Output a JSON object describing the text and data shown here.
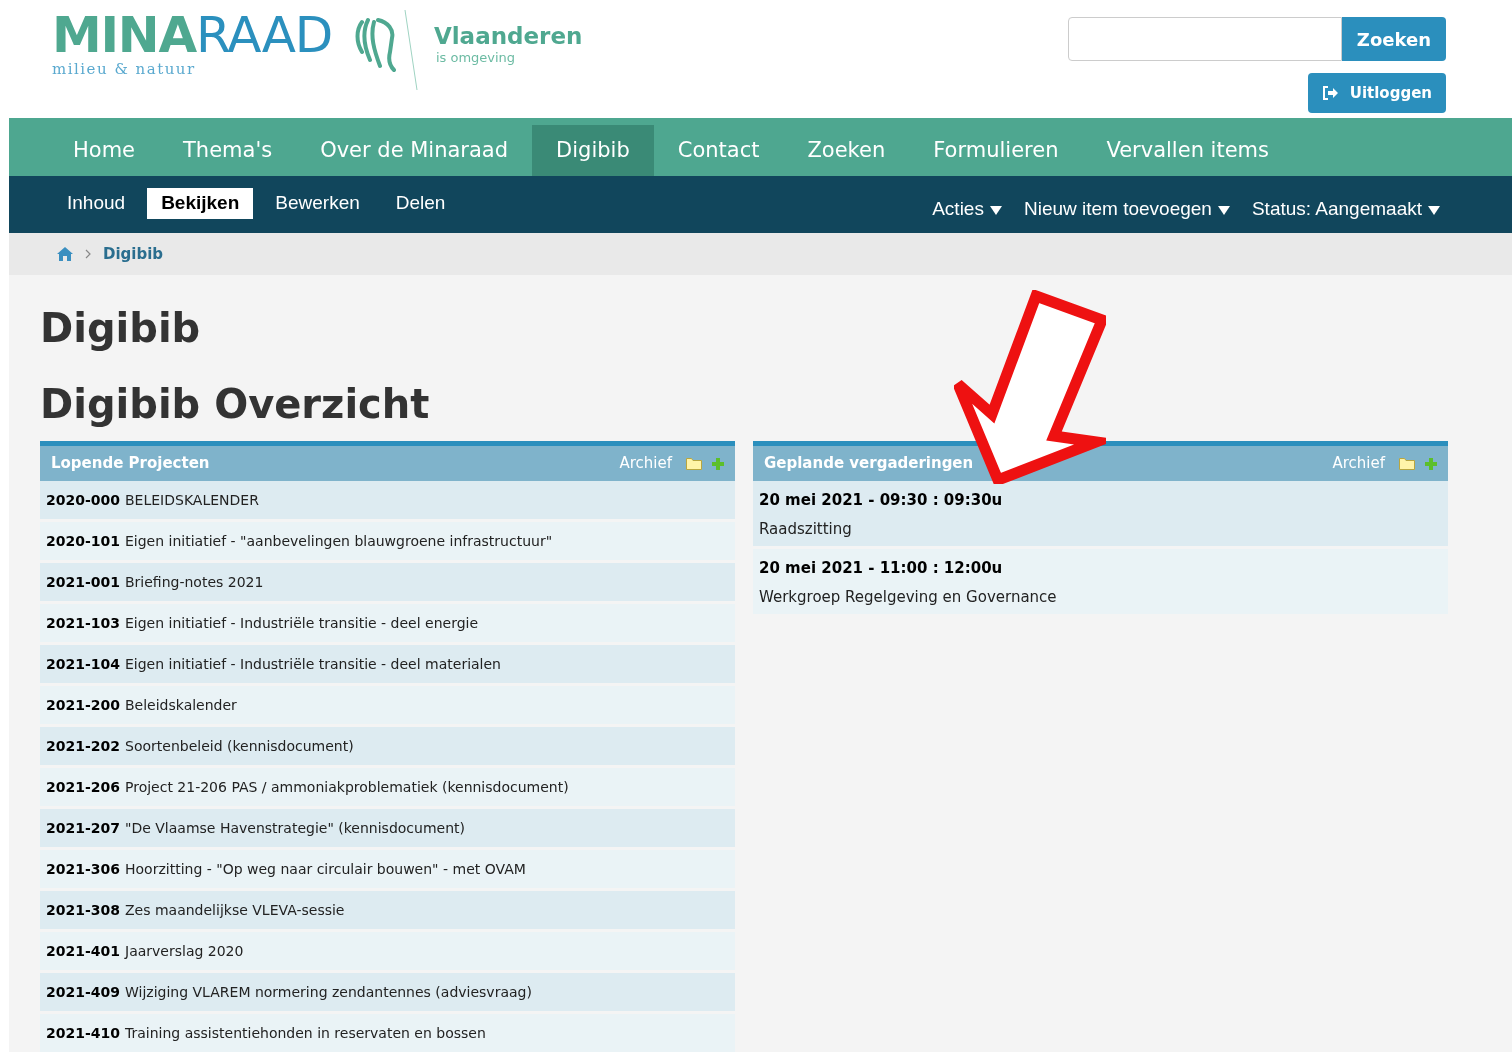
{
  "logo": {
    "part_1": "MINA",
    "part_2": "RAAD",
    "tagline": "milieu & natuur"
  },
  "partner_logo": {
    "name": "Vlaanderen",
    "tagline": "is omgeving"
  },
  "search": {
    "button": "Zoeken"
  },
  "logout": {
    "label": "Uitloggen"
  },
  "main_nav": [
    {
      "label": "Home",
      "selected": false
    },
    {
      "label": "Thema's",
      "selected": false
    },
    {
      "label": "Over de Minaraad",
      "selected": false
    },
    {
      "label": "Digibib",
      "selected": true
    },
    {
      "label": "Contact",
      "selected": false
    },
    {
      "label": "Zoeken",
      "selected": false
    },
    {
      "label": "Formulieren",
      "selected": false
    },
    {
      "label": "Vervallen items",
      "selected": false
    }
  ],
  "edit_tabs": [
    {
      "label": "Inhoud",
      "selected": false
    },
    {
      "label": "Bekijken",
      "selected": true
    },
    {
      "label": "Bewerken",
      "selected": false
    },
    {
      "label": "Delen",
      "selected": false
    }
  ],
  "edit_menus": [
    "Acties",
    "Nieuw item toevoegen",
    "Status: Aangemaakt"
  ],
  "breadcrumb": [
    "Digibib"
  ],
  "title": "Digibib",
  "subtitle": "Digibib Overzicht",
  "panels": [
    {
      "title": "Lopende Projecten",
      "archive": "Archief",
      "kind": "projects",
      "items": [
        {
          "code": "2020-000",
          "text": "BELEIDSKALENDER"
        },
        {
          "code": "2020-101",
          "text": "Eigen initiatief - \"aanbevelingen blauwgroene infrastructuur\""
        },
        {
          "code": "2021-001",
          "text": "Briefing-notes 2021"
        },
        {
          "code": "2021-103",
          "text": "Eigen initiatief - Industriële transitie - deel energie"
        },
        {
          "code": "2021-104",
          "text": "Eigen initiatief - Industriële transitie - deel materialen"
        },
        {
          "code": "2021-200",
          "text": "Beleidskalender"
        },
        {
          "code": "2021-202",
          "text": "Soortenbeleid (kennisdocument)"
        },
        {
          "code": "2021-206",
          "text": "Project 21-206 PAS / ammoniakproblematiek (kennisdocument)"
        },
        {
          "code": "2021-207",
          "text": "\"De Vlaamse Havenstrategie\" (kennisdocument)"
        },
        {
          "code": "2021-306",
          "text": "Hoorzitting - \"Op weg naar circulair bouwen\" - met OVAM"
        },
        {
          "code": "2021-308",
          "text": "Zes maandelijkse VLEVA-sessie"
        },
        {
          "code": "2021-401",
          "text": "Jaarverslag 2020"
        },
        {
          "code": "2021-409",
          "text": "Wijziging VLAREM normering zendantennes (adviesvraag)"
        },
        {
          "code": "2021-410",
          "text": "Training assistentiehonden in reservaten en bossen"
        }
      ]
    },
    {
      "title": "Geplande vergaderingen",
      "archive": "Archief",
      "kind": "meetings",
      "items": [
        {
          "code": "20 mei 2021 - 09:30 : 09:30u",
          "text": "Raadszitting"
        },
        {
          "code": "20 mei 2021 - 11:00 : 12:00u",
          "text": "Werkgroep Regelgeving en Governance"
        }
      ]
    }
  ]
}
